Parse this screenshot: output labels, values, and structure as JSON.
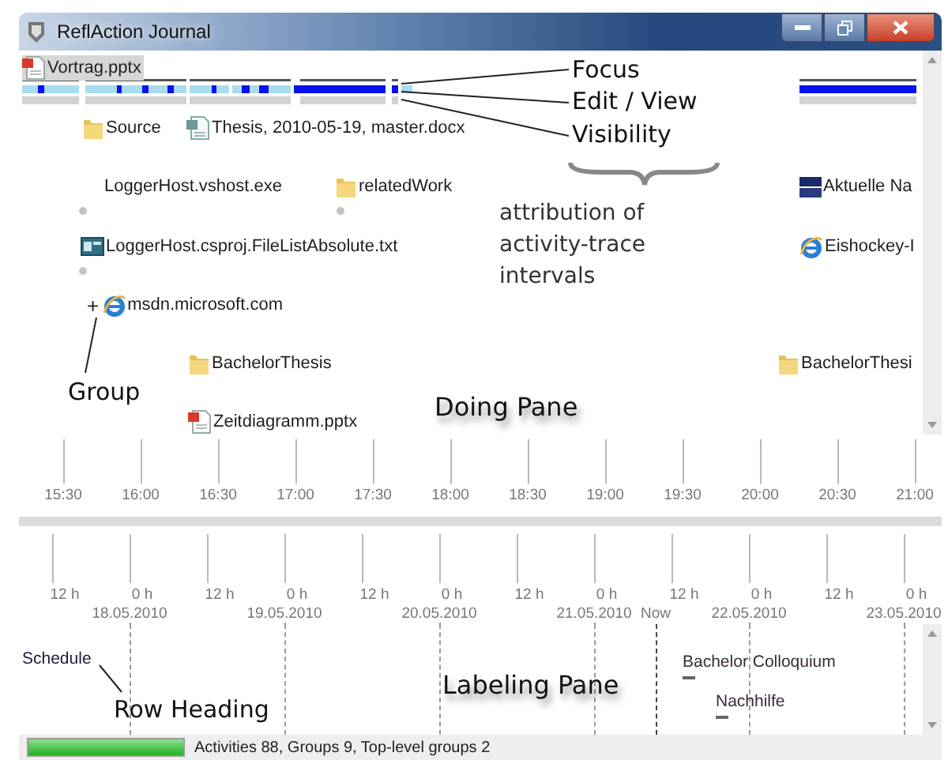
{
  "window": {
    "title": "ReflAction Journal"
  },
  "doing_pane": {
    "items": [
      {
        "label": "Vortrag.pptx",
        "kind": "pptx",
        "selected": true
      },
      {
        "label": "Source",
        "kind": "folder",
        "selected": false
      },
      {
        "label": "Thesis, 2010-05-19, master.docx",
        "kind": "docx",
        "selected": false
      },
      {
        "label": "LoggerHost.vshost.exe",
        "kind": "plain",
        "selected": false
      },
      {
        "label": "relatedWork",
        "kind": "folder",
        "selected": false
      },
      {
        "label": "Aktuelle Na",
        "kind": "news",
        "selected": false
      },
      {
        "label": "LoggerHost.csproj.FileListAbsolute.txt",
        "kind": "project",
        "selected": false
      },
      {
        "label": "Eishockey-I",
        "kind": "web",
        "selected": false
      },
      {
        "label": "msdn.microsoft.com",
        "kind": "web",
        "selected": false,
        "expander": "+"
      },
      {
        "label": "BachelorThesis",
        "kind": "folder",
        "selected": false
      },
      {
        "label": "BachelorThesi",
        "kind": "folder",
        "selected": false
      },
      {
        "label": "Zeitdiagramm.pptx",
        "kind": "pptx",
        "selected": false
      }
    ]
  },
  "time_axis": {
    "ticks": [
      "15:30",
      "16:00",
      "16:30",
      "17:00",
      "17:30",
      "18:00",
      "18:30",
      "19:00",
      "19:30",
      "20:00",
      "20:30",
      "21:00"
    ]
  },
  "day_axis": {
    "ticks": [
      {
        "label": "12 h"
      },
      {
        "label": "0 h",
        "date": "18.05.2010"
      },
      {
        "label": "12 h"
      },
      {
        "label": "0 h",
        "date": "19.05.2010"
      },
      {
        "label": "12 h"
      },
      {
        "label": "0 h",
        "date": "20.05.2010"
      },
      {
        "label": "12 h"
      },
      {
        "label": "0 h",
        "date": "21.05.2010"
      },
      {
        "label": "12 h"
      },
      {
        "label": "0 h",
        "date": "22.05.2010"
      },
      {
        "label": "12 h"
      },
      {
        "label": "0 h",
        "date": "23.05.2010"
      }
    ],
    "now": "Now"
  },
  "labeling_pane": {
    "row_heading": "Schedule",
    "labels": [
      "Bachelor Colloquium",
      "Nachhilfe"
    ]
  },
  "status_bar": {
    "progress": {
      "level": 1
    },
    "text": "Activities 88, Groups 9, Top-level groups 2"
  },
  "annotations": [
    {
      "text": "Focus",
      "kind": "callout"
    },
    {
      "text": "Edit / View",
      "kind": "callout"
    },
    {
      "text": "Visibility",
      "kind": "callout"
    },
    {
      "text": "attribution of activity-trace intervals",
      "kind": "note"
    },
    {
      "text": "Group",
      "kind": "callout"
    },
    {
      "text": "Doing Pane",
      "kind": "pane-label"
    },
    {
      "text": "Row Heading",
      "kind": "callout"
    },
    {
      "text": "Labeling Pane",
      "kind": "pane-label"
    }
  ]
}
